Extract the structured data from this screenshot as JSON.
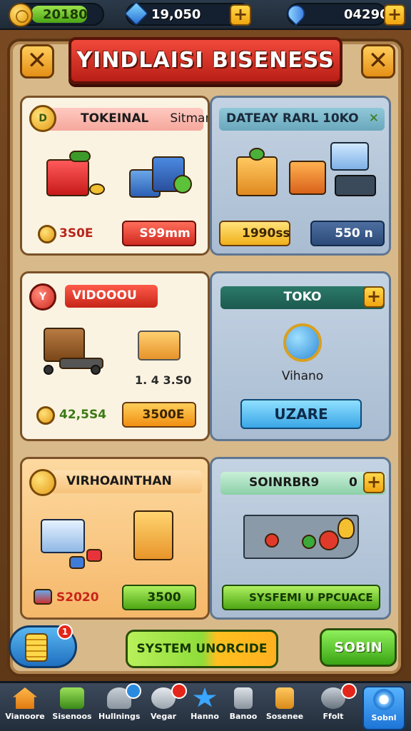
{
  "topbar": {
    "coins": "20180",
    "gems": "19,050",
    "diamonds": "04290",
    "plus_label": "+"
  },
  "title": "YINDLAISI BISENESS",
  "close_left": "✕",
  "close_right": "✕",
  "panels": {
    "tl": {
      "badge": "D",
      "tag": "TOKEINAL",
      "subtitle": "Sitman",
      "price_left": "3S0E",
      "price_right": "S99mm"
    },
    "tr": {
      "title": "DATEAY RARL 10KO",
      "close": "✕",
      "price_left": "1990ss",
      "price_right": "550 n"
    },
    "ml": {
      "badge": "Y",
      "tag": "VIDOOOU",
      "cart_value": "1. 4 3.S0",
      "price_left": "42,5S4",
      "price_right": "3500E"
    },
    "mr": {
      "title": "TOKO",
      "plus": "+",
      "item_label": "Vihano",
      "button": "UZARE"
    },
    "bl": {
      "tag": "VIRHOAINTHAN",
      "price_left": "S2020",
      "price_right": "3500"
    },
    "br": {
      "title": "SOINRBR9",
      "count": "0",
      "plus": "+",
      "button": "SYSFEMI U PPCUACE"
    }
  },
  "bottom": {
    "coin_badge": "1",
    "upgrade_button": "SYSTEM UNORCIDE",
    "right_button": "SOBIN"
  },
  "nav": [
    {
      "label": "Vianoore",
      "badge": ""
    },
    {
      "label": "Sisenoos",
      "badge": ""
    },
    {
      "label": "Hullnings",
      "badge": ""
    },
    {
      "label": "Vegar",
      "badge": ""
    },
    {
      "label": "Hanno",
      "badge": ""
    },
    {
      "label": "Banoo",
      "badge": ""
    },
    {
      "label": "Sosenee",
      "badge": ""
    },
    {
      "label": "Ffolt",
      "badge": ""
    },
    {
      "label": "Sobnl",
      "badge": ""
    }
  ],
  "colors": {
    "accent_red": "#d02a20",
    "accent_green": "#4da614",
    "accent_blue": "#1f6fbf",
    "frame_brown": "#5a3412"
  }
}
